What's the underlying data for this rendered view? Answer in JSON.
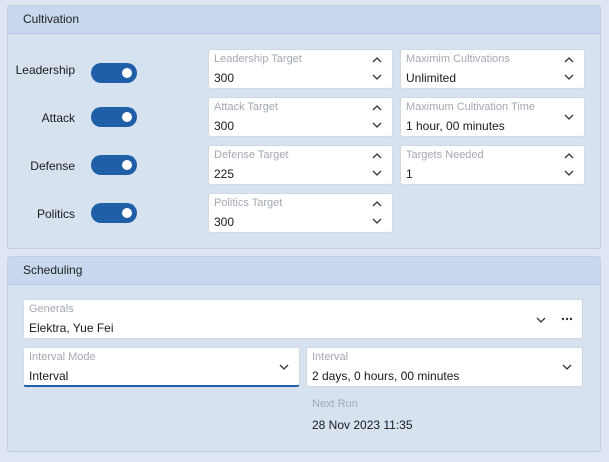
{
  "cultivation": {
    "title": "Cultivation",
    "toggles": [
      {
        "label": "Leadership",
        "on": true
      },
      {
        "label": "Attack",
        "on": true
      },
      {
        "label": "Defense",
        "on": true
      },
      {
        "label": "Politics",
        "on": true
      }
    ],
    "targets": [
      {
        "label": "Leadership Target",
        "value": "300"
      },
      {
        "label": "Attack Target",
        "value": "300"
      },
      {
        "label": "Defense Target",
        "value": "225"
      },
      {
        "label": "Politics Target",
        "value": "300"
      }
    ],
    "max_cultivations": {
      "label": "Maximim Cultivations",
      "value": "Unlimited"
    },
    "max_time": {
      "label": "Maximum Cultivation Time",
      "value": "1 hour, 00 minutes"
    },
    "targets_needed": {
      "label": "Targets Needed",
      "value": "1"
    }
  },
  "scheduling": {
    "title": "Scheduling",
    "generals": {
      "label": "Generals",
      "value": "Elektra, Yue Fei"
    },
    "interval_mode": {
      "label": "Interval Mode",
      "value": "Interval"
    },
    "interval": {
      "label": "Interval",
      "value": "2 days, 0 hours, 00 minutes"
    },
    "next_run": {
      "label": "Next Run",
      "value": "28 Nov 2023 11:35"
    }
  },
  "colors": {
    "accent": "#1f5fa8",
    "background": "#dde6f2",
    "header": "#c8d8ee"
  },
  "icons": {
    "cursor": "mouse-pointer-icon",
    "spin_up": "chevron-up-icon",
    "spin_down": "chevron-down-icon",
    "more": "more-icon"
  }
}
